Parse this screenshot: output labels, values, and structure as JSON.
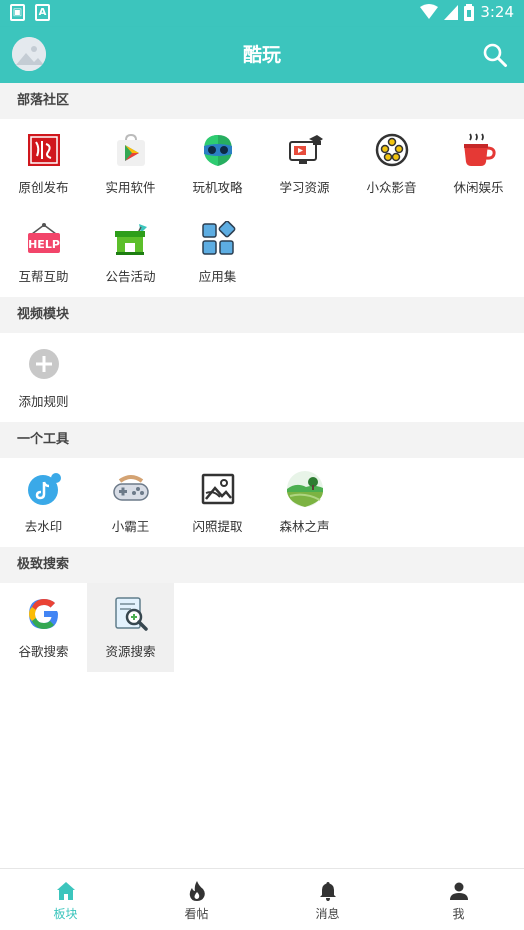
{
  "status_bar": {
    "time": "3:24"
  },
  "toolbar": {
    "title": "酷玩"
  },
  "sections": [
    {
      "title": "部落社区",
      "items": [
        {
          "label": "原创发布",
          "icon": "seal-stamp-icon"
        },
        {
          "label": "实用软件",
          "icon": "play-store-icon"
        },
        {
          "label": "玩机攻略",
          "icon": "android-head-icon"
        },
        {
          "label": "学习资源",
          "icon": "graduation-monitor-icon"
        },
        {
          "label": "小众影音",
          "icon": "film-reel-icon"
        },
        {
          "label": "休闲娱乐",
          "icon": "hot-cup-icon"
        },
        {
          "label": "互帮互助",
          "icon": "help-sign-icon"
        },
        {
          "label": "公告活动",
          "icon": "shop-announcement-icon"
        },
        {
          "label": "应用集",
          "icon": "app-grid-icon"
        }
      ]
    },
    {
      "title": "视频模块",
      "items": [
        {
          "label": "添加规则",
          "icon": "add-circle-icon"
        }
      ]
    },
    {
      "title": "一个工具",
      "items": [
        {
          "label": "去水印",
          "icon": "tiktok-icon"
        },
        {
          "label": "小霸王",
          "icon": "gamepad-icon"
        },
        {
          "label": "闪照提取",
          "icon": "image-frame-icon"
        },
        {
          "label": "森林之声",
          "icon": "forest-landscape-icon"
        }
      ]
    },
    {
      "title": "极致搜索",
      "items": [
        {
          "label": "谷歌搜索",
          "icon": "google-icon"
        },
        {
          "label": "资源搜索",
          "icon": "document-search-icon",
          "selected": true
        }
      ]
    }
  ],
  "bottom_nav": [
    {
      "label": "板块",
      "icon": "home-icon",
      "active": true
    },
    {
      "label": "看帖",
      "icon": "flame-icon"
    },
    {
      "label": "消息",
      "icon": "bell-icon"
    },
    {
      "label": "我",
      "icon": "person-icon"
    }
  ],
  "colors": {
    "accent": "#3cc5bd",
    "section_bg": "#f3f3f3"
  }
}
